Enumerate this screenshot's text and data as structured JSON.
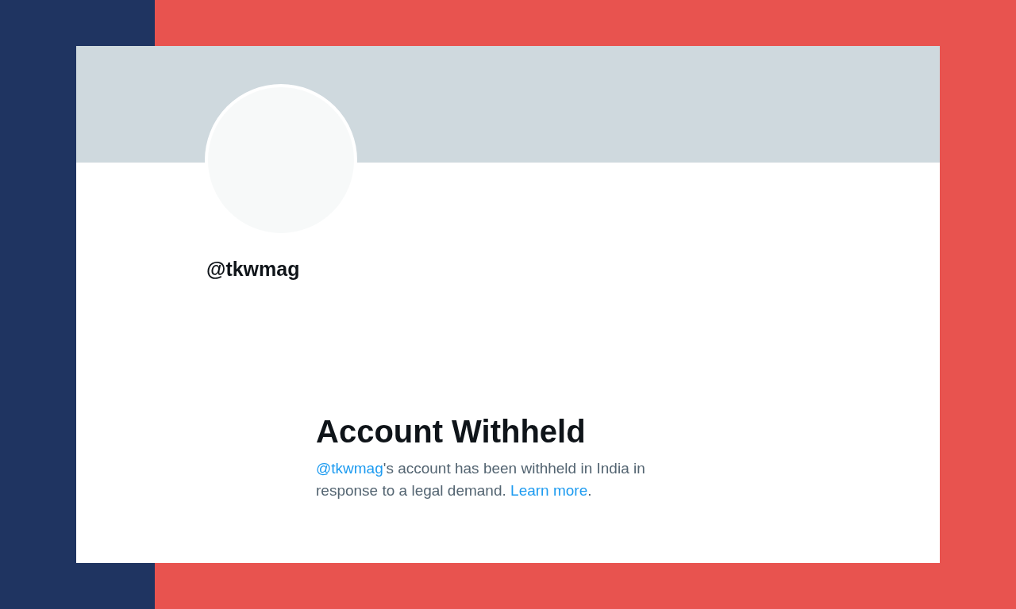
{
  "profile": {
    "handle": "@tkwmag"
  },
  "notice": {
    "title": "Account Withheld",
    "message": [
      {
        "kind": "link",
        "text": "@tkwmag"
      },
      {
        "kind": "text",
        "text": "'s account has been withheld in India in response to a legal demand. "
      },
      {
        "kind": "link",
        "text": "Learn more"
      },
      {
        "kind": "text",
        "text": "."
      }
    ]
  }
}
